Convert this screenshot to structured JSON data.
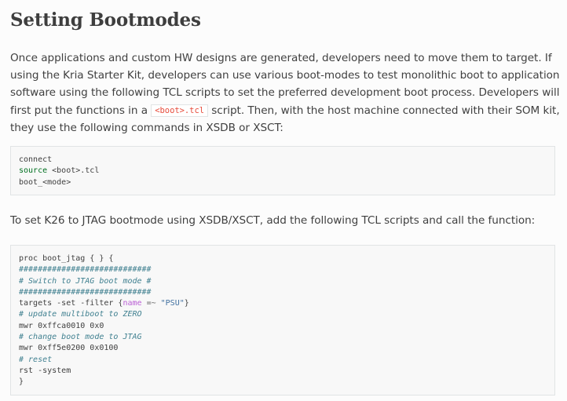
{
  "heading": "Setting Bootmodes",
  "intro": {
    "text_before": "Once applications and custom HW designs are generated, developers need to move them to target. If using the Kria Starter Kit, developers can use various boot-modes to test monolithic boot to application software using the following TCL scripts to set the preferred development boot process. Developers will first put the functions in a ",
    "inline_code": "<boot>.tcl",
    "text_after": " script. Then, with the host machine connected with their SOM kit, they use the following commands in XSDB or XSCT:"
  },
  "code1": {
    "line1": "connect",
    "line2_kw": "source",
    "line2_rest": " <boot>.tcl",
    "line3": "boot_<mode>"
  },
  "jtag_intro": "To set K26 to JTAG bootmode using XSDB/XSCT, add the following TCL scripts and call the function:",
  "code2": {
    "l1": "proc boot_jtag { } {",
    "l2": "############################",
    "l3": "# Switch to JTAG boot mode #",
    "l4": "############################",
    "l5_a": "targets -set -filter {",
    "l5_name": "name",
    "l5_op": " =~ ",
    "l5_str": "\"PSU\"",
    "l5_b": "}",
    "l6": "# update multiboot to ZERO",
    "l7": "mwr 0xffca0010 0x0",
    "l8": "# change boot mode to JTAG",
    "l9": "mwr 0xff5e0200 0x0100",
    "l10": "# reset",
    "l11": "rst -system",
    "l12": "}"
  }
}
